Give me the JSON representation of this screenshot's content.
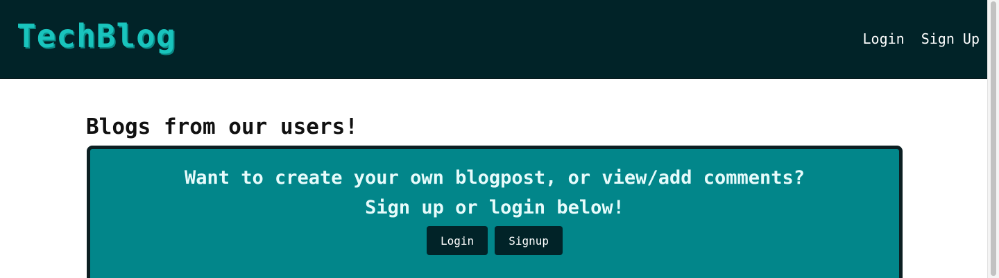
{
  "header": {
    "logo_text": "TechBlog",
    "nav": {
      "login_label": "Login",
      "signup_label": "Sign Up"
    }
  },
  "main": {
    "page_title": "Blogs from our users!",
    "cta": {
      "line1": "Want to create your own blogpost, or view/add comments?",
      "line2": "Sign up or login below!",
      "login_button": "Login",
      "signup_button": "Signup"
    }
  },
  "colors": {
    "navbar_bg": "#012328",
    "logo": "#19c4bd",
    "card_bg": "#02868a",
    "card_text": "#e6fbfb",
    "button_bg": "#012328"
  }
}
